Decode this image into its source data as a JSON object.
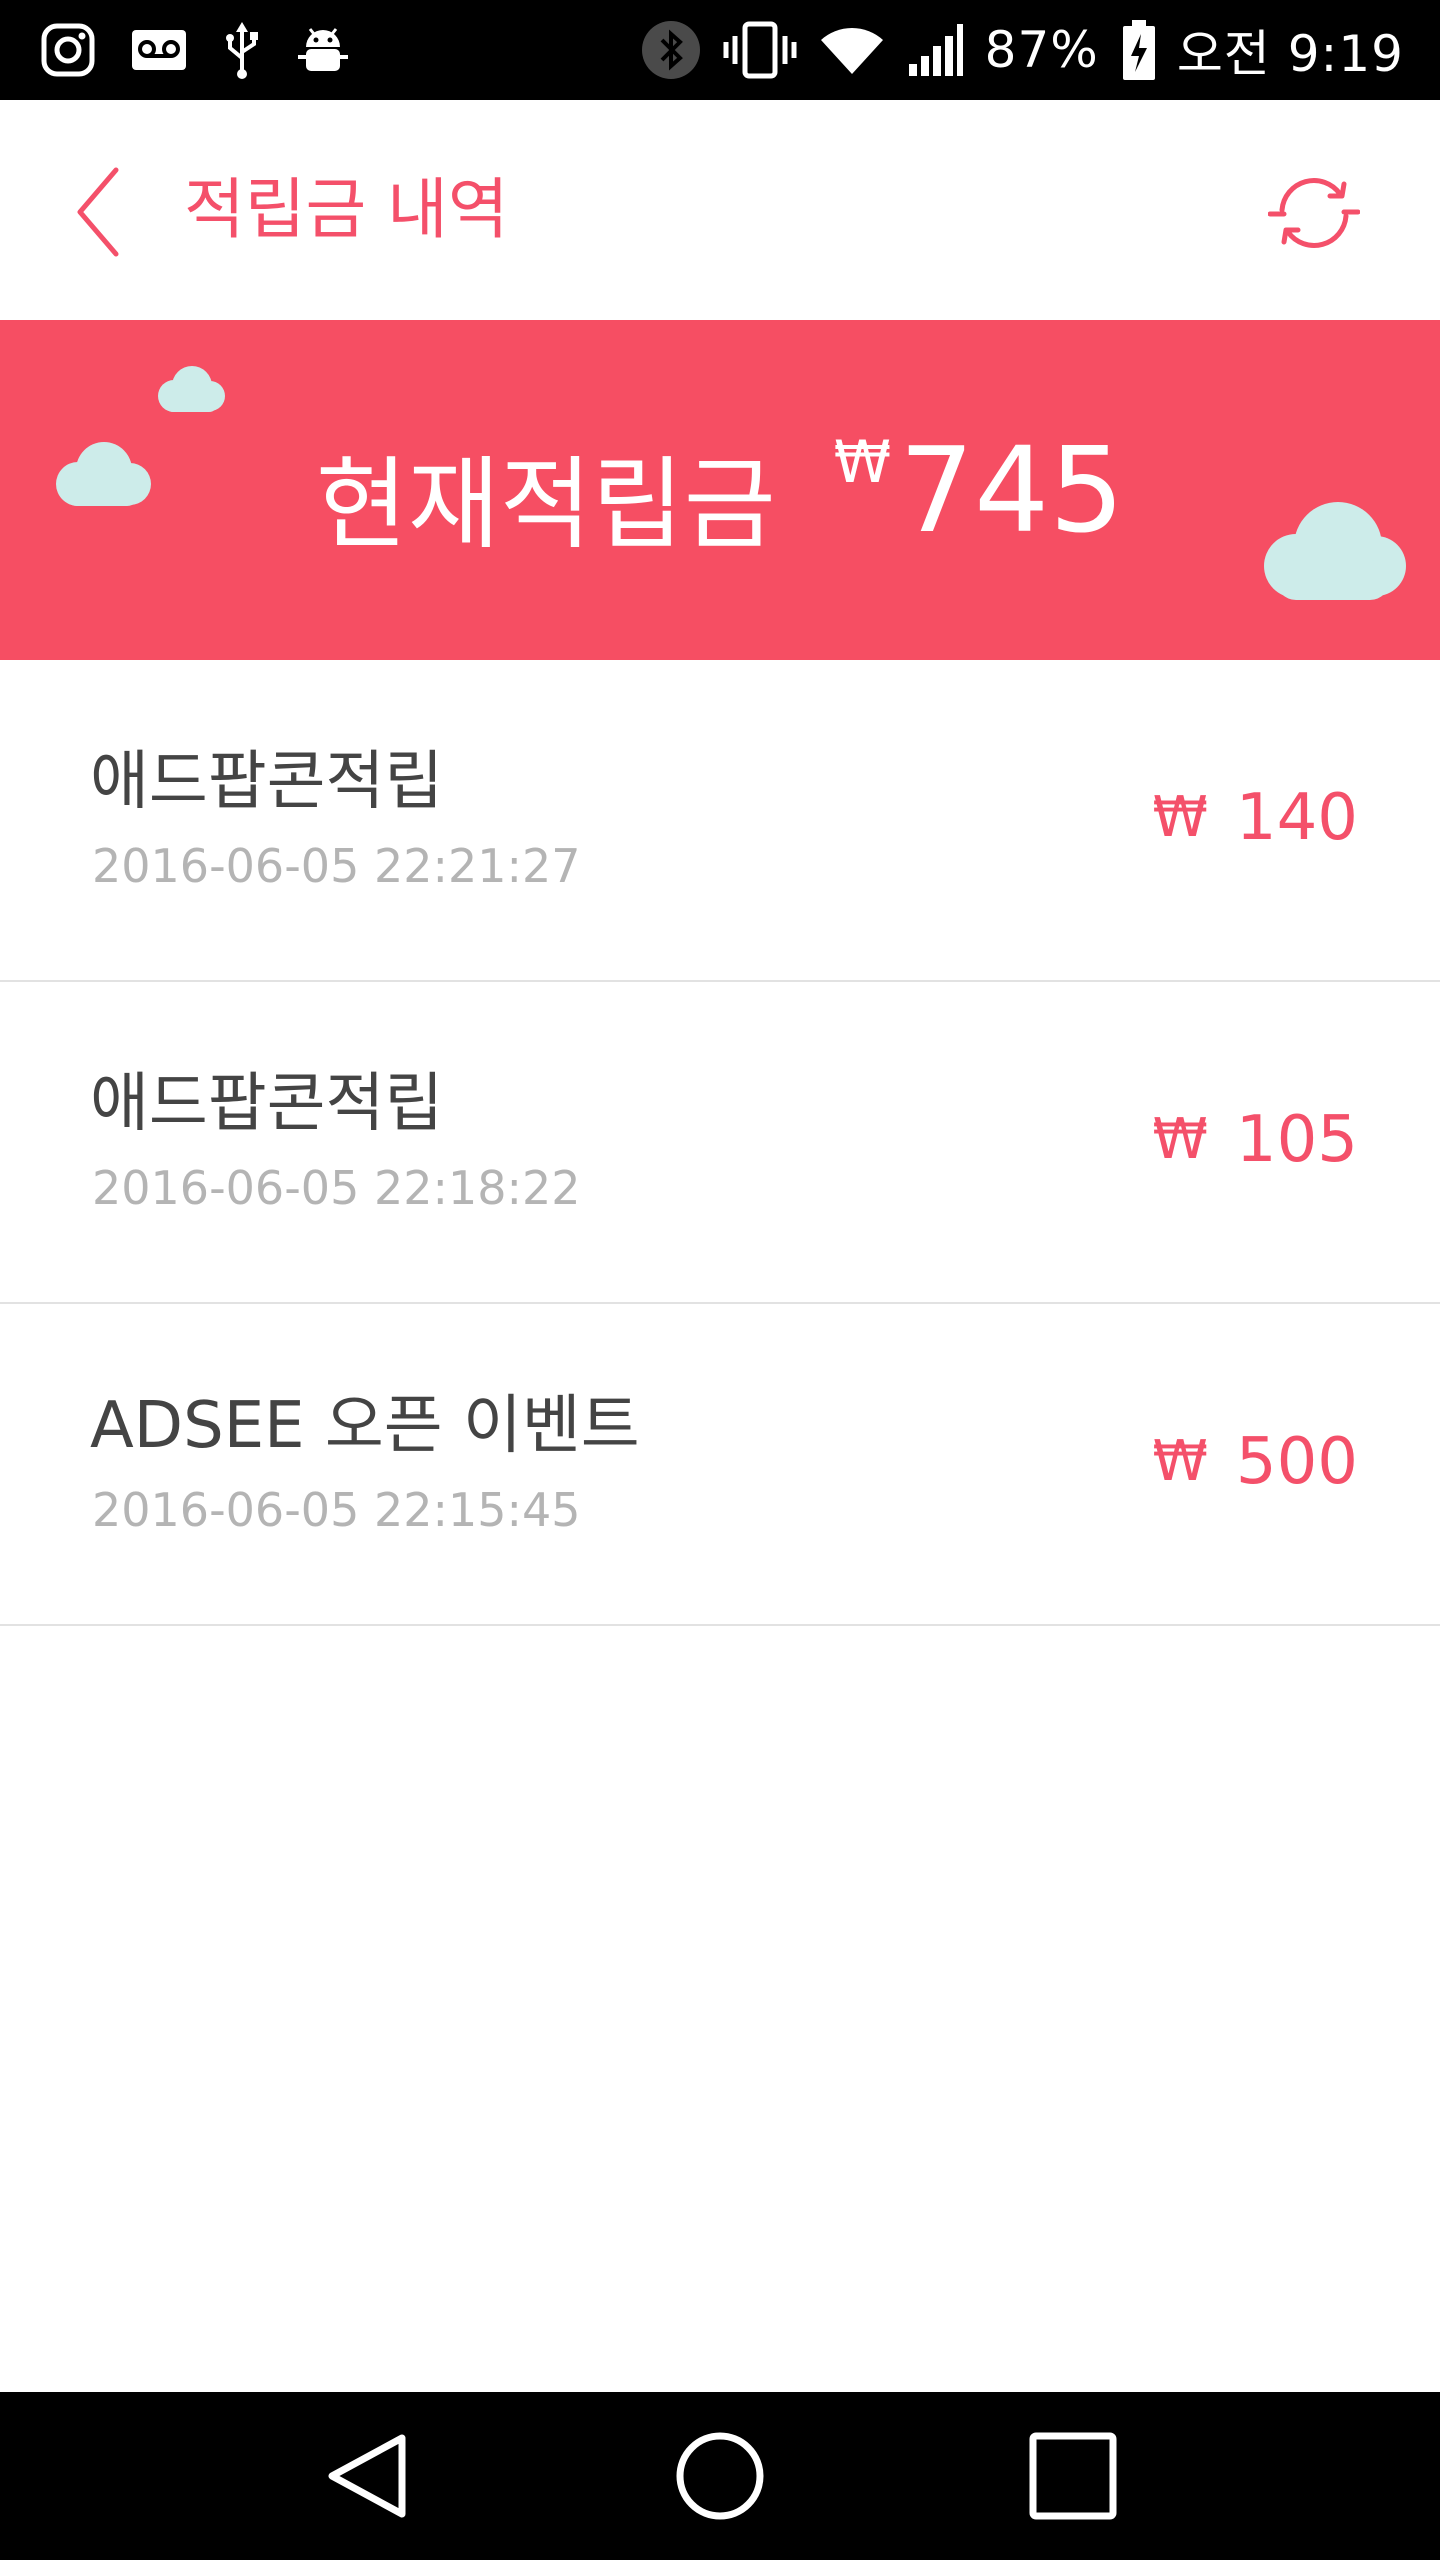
{
  "status_bar": {
    "battery": "87%",
    "time": "오전 9:19",
    "icons_left": [
      "instagram-icon",
      "voicemail-icon",
      "usb-icon",
      "android-debug-icon"
    ],
    "icons_right": [
      "bluetooth-icon",
      "vibrate-icon",
      "wifi-icon",
      "signal-icon",
      "battery-charging-icon"
    ]
  },
  "header": {
    "title": "적립금 내역",
    "back_icon": "chevron-left-icon",
    "refresh_icon": "refresh-icon"
  },
  "balance": {
    "label": "현재적립금",
    "currency": "₩",
    "amount": "745"
  },
  "history": [
    {
      "title": "애드팝콘적립",
      "date": "2016-06-05 22:21:27",
      "currency": "₩",
      "amount": "140"
    },
    {
      "title": "애드팝콘적립",
      "date": "2016-06-05 22:18:22",
      "currency": "₩",
      "amount": "105"
    },
    {
      "title": "ADSEE 오픈 이벤트",
      "date": "2016-06-05 22:15:45",
      "currency": "₩",
      "amount": "500"
    }
  ],
  "nav": {
    "back_icon": "nav-back-icon",
    "home_icon": "nav-home-icon",
    "recents_icon": "nav-recents-icon"
  },
  "colors": {
    "accent": "#f4506a",
    "banner": "#f64e63",
    "cloud": "#cdecea"
  }
}
